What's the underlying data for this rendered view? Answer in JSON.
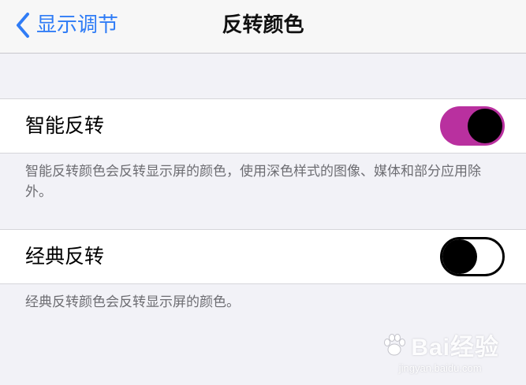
{
  "nav": {
    "back_label": "显示调节",
    "title": "反转颜色",
    "accent_color": "#2f7cf6"
  },
  "settings": [
    {
      "label": "智能反转",
      "toggle_state": "on",
      "toggle_color": "#b9309f",
      "description": "智能反转颜色会反转显示屏的颜色，使用深色样式的图像、媒体和部分应用除外。"
    },
    {
      "label": "经典反转",
      "toggle_state": "off",
      "description": "经典反转颜色会反转显示屏的颜色。"
    }
  ],
  "watermark": {
    "logo": "Bai经验",
    "sub": "jingyan.baidu.com"
  }
}
